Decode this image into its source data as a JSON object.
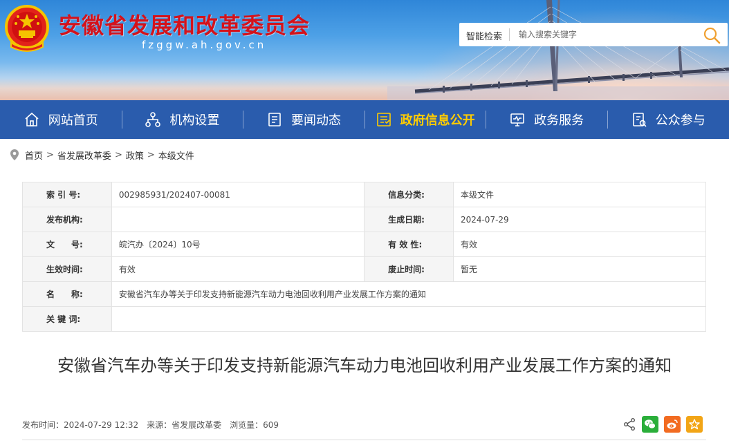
{
  "site": {
    "title": "安徽省发展和改革委员会",
    "domain": "fzggw.ah.gov.cn"
  },
  "search": {
    "label": "智能检索",
    "placeholder": "输入搜索关键字"
  },
  "nav": {
    "items": [
      {
        "label": "网站首页",
        "icon": "home-icon"
      },
      {
        "label": "机构设置",
        "icon": "org-chart-icon"
      },
      {
        "label": "要闻动态",
        "icon": "news-icon"
      },
      {
        "label": "政府信息公开",
        "icon": "document-list-icon",
        "active": true
      },
      {
        "label": "政务服务",
        "icon": "monitor-icon"
      },
      {
        "label": "公众参与",
        "icon": "survey-icon"
      }
    ]
  },
  "breadcrumb": {
    "items": [
      "首页",
      "省发展改革委",
      "政策",
      "本级文件"
    ],
    "separator": ">"
  },
  "info": {
    "index_label": "索 引 号:",
    "index_value": "002985931/202407-00081",
    "category_label": "信息分类:",
    "category_value": "本级文件",
    "publisher_label": "发布机构:",
    "publisher_value": "",
    "created_label": "生成日期:",
    "created_value": "2024-07-29",
    "docno_label": "文　　号:",
    "docno_value": "皖汽办〔2024〕10号",
    "validity_label": "有 效 性:",
    "validity_value": "有效",
    "effective_label": "生效时间:",
    "effective_value": "有效",
    "repeal_label": "废止时间:",
    "repeal_value": "暂无",
    "name_label": "名　　称:",
    "name_value": "安徽省汽车办等关于印发支持新能源汽车动力电池回收利用产业发展工作方案的通知",
    "keywords_label": "关 键 词:",
    "keywords_value": ""
  },
  "article": {
    "title": "安徽省汽车办等关于印发支持新能源汽车动力电池回收利用产业发展工作方案的通知",
    "publish_time": "发布时间：2024-07-29 12:32",
    "source": "来源：省发展改革委",
    "views": "浏览量：609"
  },
  "colors": {
    "brand_red": "#d4121b",
    "nav_blue": "#2a5cad",
    "active_yellow": "#ffcc00",
    "wechat_green": "#2aae3a",
    "weibo_orange": "#f26b21",
    "favorite_orange": "#f2a516"
  }
}
